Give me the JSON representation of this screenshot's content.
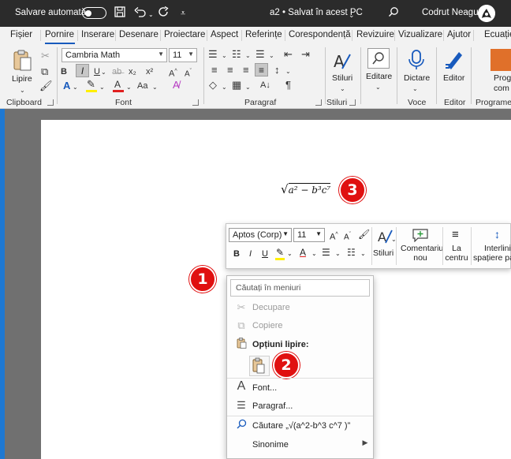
{
  "titlebar": {
    "autosave_label": "Salvare automată",
    "autosave_state": "off",
    "doc_title": "a2 • Salvat în acest PC",
    "user_name": "Codrut Neagu"
  },
  "tabs": [
    "Fișier",
    "Pornire",
    "Inserare",
    "Desenare",
    "Proiectare",
    "Aspect",
    "Referințe",
    "Corespondență",
    "Revizuire",
    "Vizualizare",
    "Ajutor",
    "Ecuație"
  ],
  "active_tab": "Pornire",
  "ribbon": {
    "clipboard": {
      "paste_label": "Lipire",
      "group_label": "Clipboard"
    },
    "font": {
      "font_name": "Cambria Math",
      "font_size": "11",
      "group_label": "Font"
    },
    "paragraph": {
      "group_label": "Paragraf"
    },
    "styles": {
      "label": "Stiluri",
      "group_label": "Stiluri"
    },
    "editing": {
      "label": "Editare"
    },
    "voice": {
      "label": "Dictare",
      "group_label": "Voce"
    },
    "editor": {
      "label": "Editor",
      "group_label": "Editor"
    },
    "programs": {
      "label_1": "Progr",
      "label_2": "com",
      "group_label": "Programe d"
    }
  },
  "document": {
    "equation_radical": "√",
    "equation_text": "a² − b³c⁷"
  },
  "markers": [
    "1",
    "2",
    "3"
  ],
  "mini_toolbar": {
    "font_name": "Aptos (Corp)",
    "font_size": "11",
    "bold": "B",
    "italic": "I",
    "underline": "U",
    "styles_label": "Stiluri",
    "comment_label_1": "Comentariu",
    "comment_label_2": "nou",
    "center_label_1": "La",
    "center_label_2": "centru",
    "spacing_label_1": "Interlinii",
    "spacing_label_2": "spațiere pa"
  },
  "context_menu": {
    "search_placeholder": "Căutați în meniuri",
    "cut": "Decupare",
    "copy": "Copiere",
    "paste_options": "Opțiuni lipire:",
    "font": "Font...",
    "paragraph": "Paragraf...",
    "search_item": "Căutare „√(a^2-b^3 c^7 )”",
    "synonyms": "Sinonime"
  },
  "colors": {
    "titlebar_bg": "#2b2b2b",
    "ribbon_bg": "#f2f2f2",
    "accent_blue": "#185abd",
    "marker_red": "#e01010",
    "highlight_yellow": "#ffef00",
    "font_red": "#e02020"
  }
}
